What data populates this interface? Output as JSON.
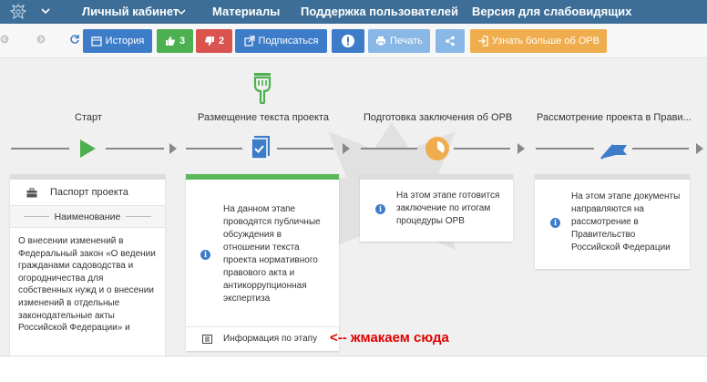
{
  "topnav": {
    "items": [
      {
        "label": "Личный кабинет"
      },
      {
        "label": "Материалы"
      },
      {
        "label": "Поддержка пользователей"
      },
      {
        "label": "Версия для слабовидящих"
      }
    ]
  },
  "toolbar": {
    "history_label": "История",
    "likes": "3",
    "dislikes": "2",
    "subscribe_label": "Подписаться",
    "print_label": "Печать",
    "learn_more_label": "Узнать больше об ОРВ"
  },
  "steps": [
    {
      "label": "Старт"
    },
    {
      "label": "Размещение текста проекта"
    },
    {
      "label": "Подготовка заключения об ОРВ"
    },
    {
      "label": "Рассмотрение проекта в Прави..."
    }
  ],
  "card1": {
    "passport_label": "Паспорт проекта",
    "name_header": "Наименование",
    "name_text": "О внесении изменений в Федеральный закон «О ведении гражданами садоводства и огородничества для собственных нужд и о внесении изменений в отдельные законодательные акты Российской Федерации» и"
  },
  "card2": {
    "text": "На данном этапе проводятся публичные обсуждения в отношении текста проекта нормативного правового акта и антикоррупционная экспертиза",
    "info_link": "Информация по этапу"
  },
  "card3": {
    "text": "На этом этапе готовится заключение по итогам процедуры ОРВ"
  },
  "card4": {
    "text": "На этом этапе документы направляются на рассмотрение в Правительство Российской Федерации"
  },
  "annotation": "<-- жмакаем сюда",
  "colors": {
    "nav_bg": "#3c6e97",
    "blue": "#3d7cc9",
    "green": "#4cb050",
    "red": "#d9534f",
    "orange": "#f0ad4e",
    "annotation": "#e00000"
  }
}
